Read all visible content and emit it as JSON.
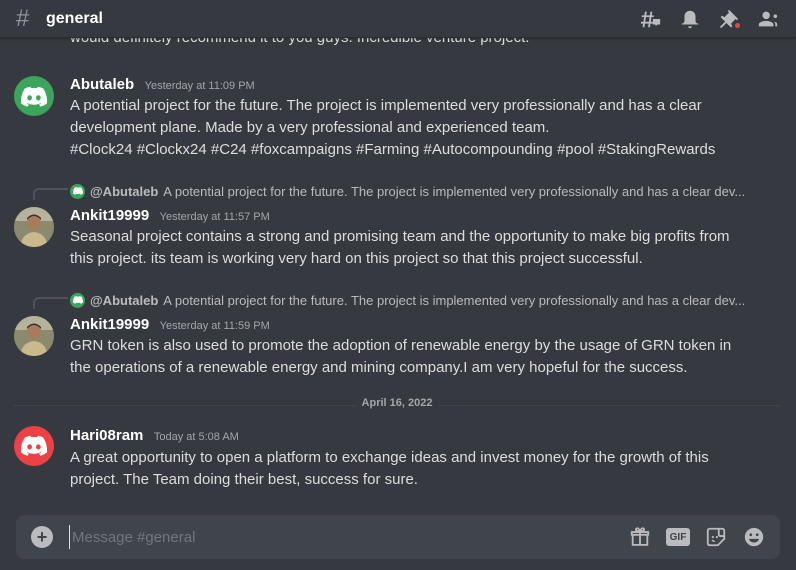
{
  "header": {
    "hash": "#",
    "channel": "general"
  },
  "messages": {
    "truncated_text": "would definitely recommend it to you guys. Incredible venture project.",
    "m1": {
      "author": "Abutaleb",
      "timestamp": "Yesterday at 11:09 PM",
      "line1": "A potential project for the future. The project is implemented very professionally and has a clear",
      "line2": "development plane. Made by a very professional and experienced team.",
      "line3": "#Clock24 #Clockx24 #C24 #foxcampaigns #Farming #Autocompounding #pool #StakingRewards"
    },
    "m2": {
      "reply_author": "@Abutaleb",
      "reply_text": "A potential project for the future. The project is implemented very professionally and has a clear dev...",
      "author": "Ankit19999",
      "timestamp": "Yesterday at 11:57 PM",
      "line1": "Seasonal project contains a strong and promising team and the opportunity to make big profits from",
      "line2": "this project. its team is working very hard on this project so that this project successful."
    },
    "m3": {
      "reply_author": "@Abutaleb",
      "reply_text": "A potential project for the future. The project is implemented very professionally and has a clear dev...",
      "author": "Ankit19999",
      "timestamp": "Yesterday at 11:59 PM",
      "line1": "GRN token is also used to promote the adoption of renewable energy by the usage of GRN token in",
      "line2": "the operations of a renewable energy and mining company.I am very hopeful for the success."
    },
    "divider": "April 16, 2022",
    "m4": {
      "author": "Hari08ram",
      "timestamp": "Today at 5:08 AM",
      "line1": "A great opportunity to open a platform to exchange ideas and invest money for the growth of this",
      "line2": "project. The Team doing their best, success for sure."
    }
  },
  "composer": {
    "placeholder": "Message #general",
    "plus": "+",
    "gif": "GIF"
  },
  "colors": {
    "background": "#36393f",
    "composer": "#40444b",
    "green_avatar": "#3ba55c",
    "red_avatar": "#ed4245",
    "notification": "#ed4245"
  },
  "icons": [
    "threads-icon",
    "bell-icon",
    "pin-icon",
    "members-icon",
    "gift-icon",
    "gif-icon",
    "sticker-icon",
    "emoji-icon"
  ]
}
